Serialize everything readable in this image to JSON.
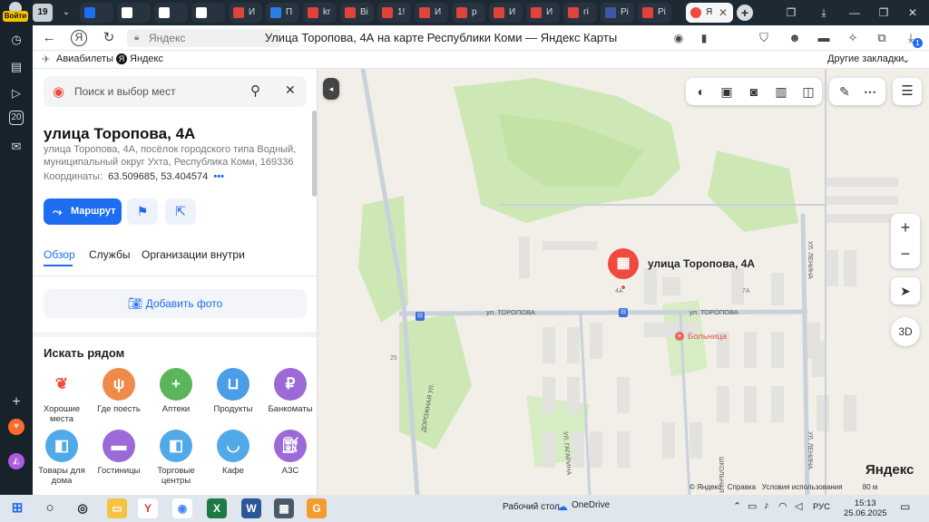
{
  "browser": {
    "login_label": "Войти",
    "tab_count": "19",
    "tabs": [
      {
        "label": "",
        "color": "#1e6cf0"
      },
      {
        "label": "",
        "color": "#ffffff"
      },
      {
        "label": "",
        "color": "#ffffff"
      },
      {
        "label": "",
        "color": "#ffffff"
      },
      {
        "label": "И",
        "color": "#e0433a"
      },
      {
        "label": "П",
        "color": "#2b7de9"
      },
      {
        "label": "kr",
        "color": "#e0433a"
      },
      {
        "label": "Вi",
        "color": "#e0433a"
      },
      {
        "label": "1!",
        "color": "#e0433a"
      },
      {
        "label": "И",
        "color": "#e0433a"
      },
      {
        "label": "р",
        "color": "#e0433a"
      },
      {
        "label": "И",
        "color": "#e0433a"
      },
      {
        "label": "И",
        "color": "#e0433a"
      },
      {
        "label": "гі",
        "color": "#e0433a"
      },
      {
        "label": "Рі",
        "color": "#3b57a5"
      },
      {
        "label": "Рі",
        "color": "#e0433a"
      }
    ],
    "active_tab_icon_color": "#f04a3e",
    "address_domain": "Яндекс",
    "page_title": "Улица Торопова, 4А на карте Республики Коми — Яндекс Карты",
    "bookmarks": {
      "item1": "Авиабилеты",
      "item2": "Яндекс",
      "other": "Другие закладки"
    },
    "badge_count": "1"
  },
  "panel": {
    "search_placeholder": "Поиск и выбор мест",
    "place_title": "улица Торопова, 4А",
    "place_address": "улица Торопова, 4А, посёлок городского типа Водный, муниципальный округ Ухта, Республика Коми, 169336",
    "coords_label": "Координаты:",
    "coords_value": "63.509685, 53.404574",
    "route_button": "Маршрут",
    "tabs": [
      "Обзор",
      "Службы",
      "Организации внутри"
    ],
    "add_photo": "Добавить фото",
    "nearby_title": "Искать рядом",
    "categories": [
      {
        "label": "Хорошие места",
        "color": "#ffffff",
        "icon": "laurel-pin-icon"
      },
      {
        "label": "Где поесть",
        "color": "#f08a4b",
        "icon": "fork-knife-icon"
      },
      {
        "label": "Аптеки",
        "color": "#5bb55a",
        "icon": "cross-icon"
      },
      {
        "label": "Продукты",
        "color": "#4a9de6",
        "icon": "basket-icon"
      },
      {
        "label": "Банкоматы",
        "color": "#9b6ad6",
        "icon": "ruble-icon"
      },
      {
        "label": "Товары для дома",
        "color": "#52a9e8",
        "icon": "bag-icon"
      },
      {
        "label": "Гостиницы",
        "color": "#9b6ad6",
        "icon": "bed-icon"
      },
      {
        "label": "Торговые центры",
        "color": "#52a9e8",
        "icon": "shopping-bag-icon"
      },
      {
        "label": "Кафе",
        "color": "#52a9e8",
        "icon": "cup-icon"
      },
      {
        "label": "АЗС",
        "color": "#9b6ad6",
        "icon": "fuel-icon"
      }
    ]
  },
  "map": {
    "pin_label": "улица Торопова, 4А",
    "street_1": "ул. ТОРОПОВА",
    "street_2": "ул. ТОРОПОВА",
    "street_gagarina": "УЛ. ГАГАРИНА",
    "street_lenina": "УЛ. ЛЕНИНА",
    "street_lenina2": "УЛ. ЛЕНИНА",
    "street_dorozhnaya": "ДОРОЖНАЯ УЛ.",
    "street_shkolnaya": "ШКОЛЬНАЯ",
    "hospital": "Больница",
    "house_4a": "4А",
    "house_7a": "7А",
    "house_25": "25",
    "zoom_in": "+",
    "zoom_out": "−",
    "view_3d": "3D",
    "logo": "Яндекс",
    "footer_copyright": "© Яндекс",
    "footer_help": "Справка",
    "footer_terms": "Условия использования",
    "footer_scale": "80 м",
    "accent": "#1e6cf0",
    "pin_color": "#f04a3e",
    "park_color": "#c8e6b0",
    "road_color": "#c5cdd8"
  },
  "taskbar": {
    "desktop_label": "Рабочий стол",
    "onedrive": "OneDrive",
    "lang": "РУС",
    "time": "15:13",
    "date": "25.06.2025"
  }
}
